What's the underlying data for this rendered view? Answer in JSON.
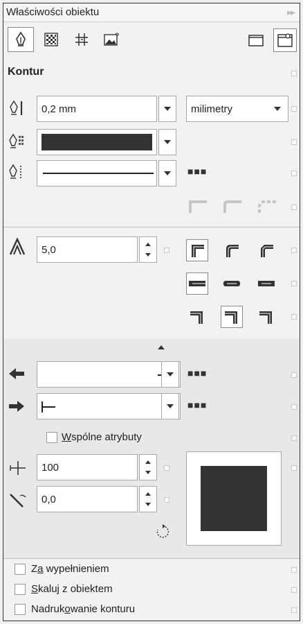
{
  "panel": {
    "title": "Właściwości obiektu",
    "tabs": [
      "outline-pen",
      "fill-pattern",
      "transparency-grid",
      "summary-image"
    ]
  },
  "contour": {
    "section_title": "Kontur",
    "width_value": "0,2 mm",
    "units_value": "milimetry",
    "color_value": "#333333",
    "line_style": "solid",
    "miter_value": "5,0"
  },
  "arrows": {
    "start": "line-end-left",
    "end": "line-start-right",
    "shared_attributes_pre": "",
    "shared_attributes_u": "W",
    "shared_attributes_post": "spólne atrybuty",
    "stretch_value": "100",
    "angle_value": "0,0"
  },
  "options": [
    {
      "pre": "Z",
      "u": "a",
      "post": " wypełnieniem"
    },
    {
      "pre": "",
      "u": "S",
      "post": "kaluj z obiektem"
    },
    {
      "pre": "Nadruk",
      "u": "o",
      "post": "wanie konturu"
    }
  ]
}
